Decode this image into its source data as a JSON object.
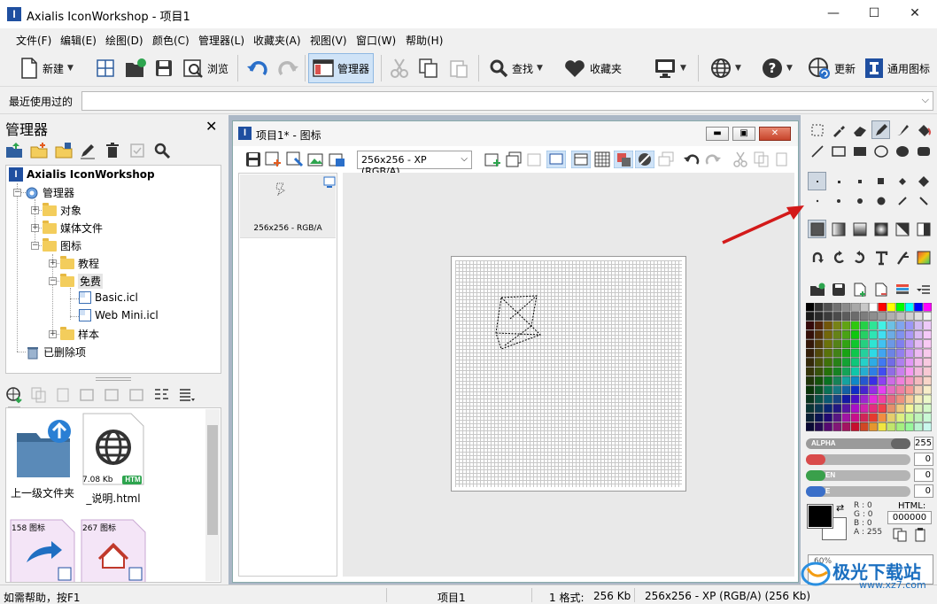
{
  "window": {
    "title": "Axialis IconWorkshop - 项目1",
    "logo_letter": "I",
    "min_glyph": "—",
    "max_glyph": "☐",
    "close_glyph": "✕"
  },
  "menu": [
    "文件(F)",
    "编辑(E)",
    "绘图(D)",
    "颜色(C)",
    "管理器(L)",
    "收藏夹(A)",
    "视图(V)",
    "窗口(W)",
    "帮助(H)"
  ],
  "toolbar": {
    "new_label": "新建",
    "browse_label": "浏览",
    "manager_label": "管理器",
    "find_label": "查找",
    "favorites_label": "收藏夹",
    "update_label": "更新",
    "universal_label": "通用图标"
  },
  "recent": {
    "label": "最近使用过的",
    "value": ""
  },
  "manager": {
    "title": "管理器",
    "close_glyph": "✕",
    "tree": {
      "root": "Axialis IconWorkshop",
      "manager": "管理器",
      "objects": "对象",
      "media": "媒体文件",
      "icons": "图标",
      "tutorial": "教程",
      "free": "免费",
      "basic": "Basic.icl",
      "webmini": "Web Mini.icl",
      "samples": "样本",
      "deleted": "已删除项"
    },
    "files": {
      "up_label": "上一级文件夹",
      "html_label": "_说明.html",
      "html_size": "7.08 Kb",
      "html_badge": "HTM",
      "tile3_count": "158 图标",
      "tile4_count": "267 图标"
    }
  },
  "document": {
    "title": "项目1* - 图标",
    "format": "256x256 - XP (RGB/A)",
    "thumb_caption": "256x256 - RGB/A",
    "min_glyph": "▬",
    "max_glyph": "▣",
    "close_glyph": "✕"
  },
  "colors": {
    "alpha_label": "ALPHA",
    "alpha_value": "255",
    "red_label": "",
    "red_value": "0",
    "green_label": "EN",
    "green_value": "0",
    "blue_label": "E",
    "blue_value": "0",
    "r_line": "R : 0",
    "g_line": "G : 0",
    "b_line": "B : 0",
    "a_line": "A : 255",
    "html_label": "HTML:",
    "html_value": "000000",
    "preview_label": "60%"
  },
  "status": {
    "help": "如需帮助，按F1",
    "project": "项目1",
    "formats": "1 格式:",
    "size": "256 Kb",
    "format_info": "256x256 - XP (RGB/A) (256 Kb)"
  },
  "watermark": {
    "text": "极光下载站",
    "url": "www.xz7.com"
  }
}
